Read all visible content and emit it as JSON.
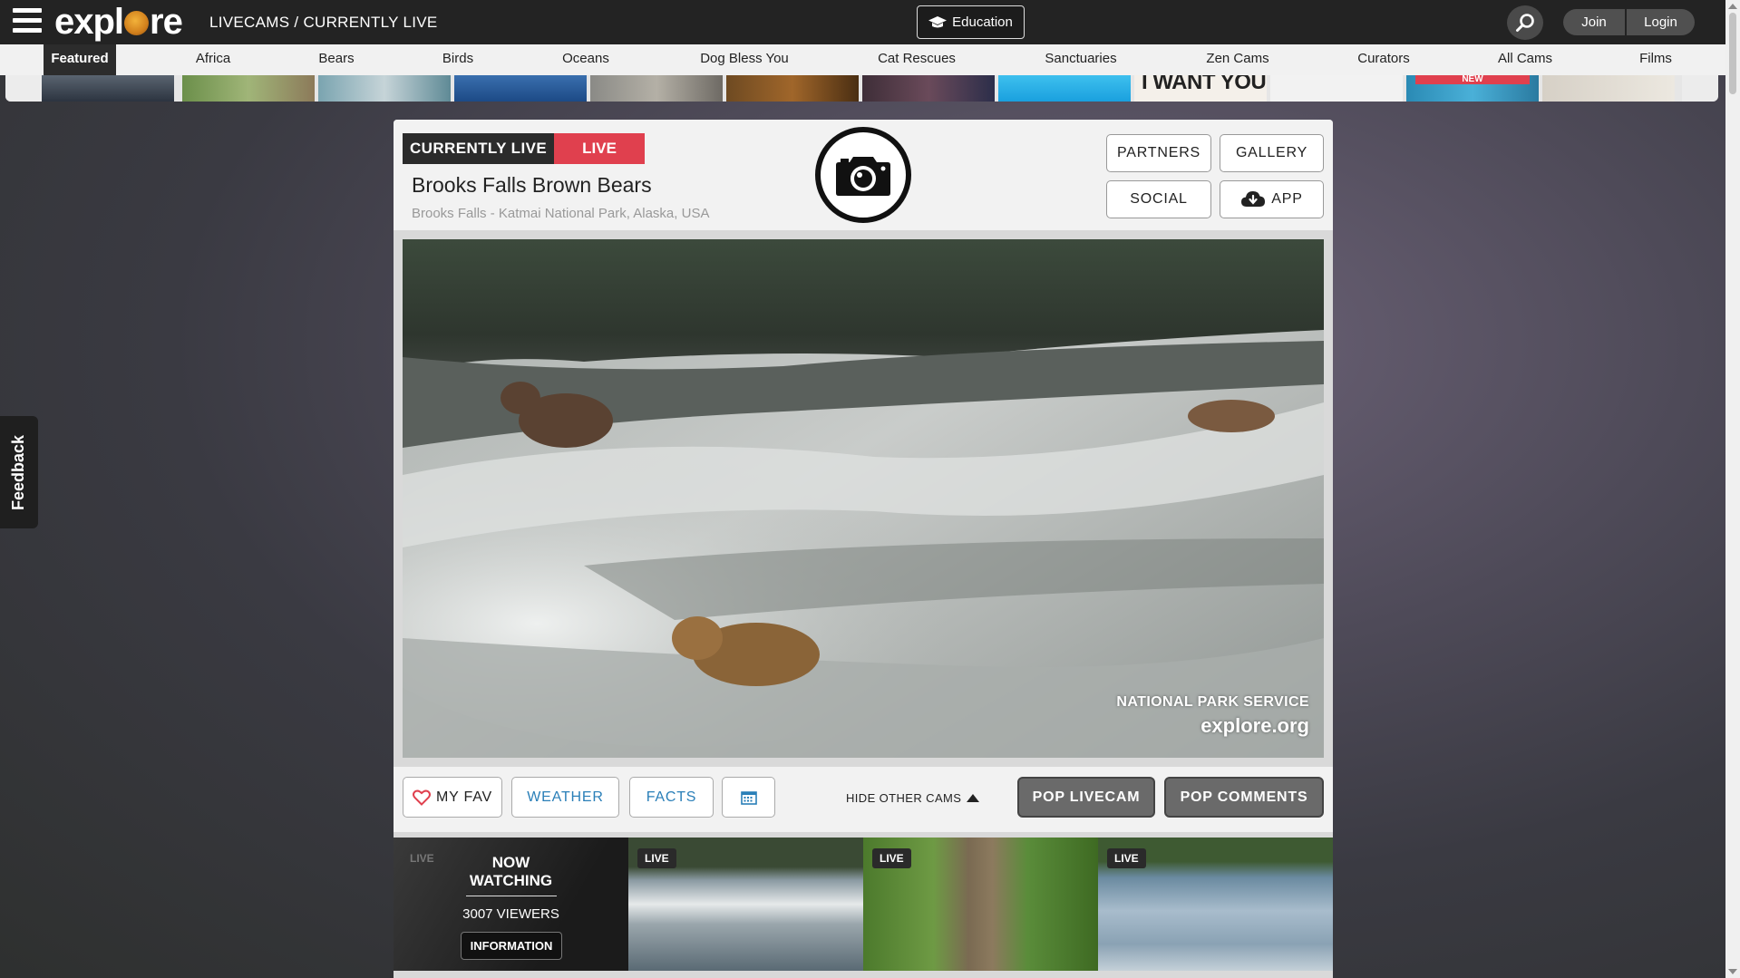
{
  "topbar": {
    "logo_text_a": "expl",
    "logo_text_b": "re",
    "breadcrumb": "LIVECAMS / CURRENTLY LIVE",
    "education_label": "Education",
    "join_label": "Join",
    "login_label": "Login"
  },
  "catnav": {
    "items": [
      "Featured",
      "Africa",
      "Bears",
      "Birds",
      "Oceans",
      "Dog Bless You",
      "Cat Rescues",
      "Sanctuaries",
      "Zen Cams",
      "Curators",
      "All Cams",
      "Films"
    ],
    "active": "Featured"
  },
  "thumbstrip": {
    "captions": [
      "I WANT YOU",
      "NEW"
    ]
  },
  "feedback_label": "Feedback",
  "panel": {
    "badge_left": "CURRENTLY LIVE",
    "badge_right": "LIVE",
    "title": "Brooks Falls Brown Bears",
    "location": "Brooks Falls - Katmai National Park, Alaska, USA",
    "buttons": {
      "partners": "PARTNERS",
      "gallery": "GALLERY",
      "social": "SOCIAL",
      "app": "APP"
    },
    "video": {
      "watermark_line1": "NATIONAL PARK SERVICE",
      "watermark_line2": "explore.org"
    },
    "controls": {
      "my_fav": "MY FAV",
      "weather": "WEATHER",
      "facts": "FACTS",
      "hide_other_cams": "HIDE OTHER CAMS",
      "pop_livecam": "POP LIVECAM",
      "pop_comments": "POP COMMENTS"
    },
    "other_cams": {
      "live_label": "LIVE",
      "now_watching_line1": "NOW",
      "now_watching_line2": "WATCHING",
      "viewers": "3007 VIEWERS",
      "information": "INFORMATION"
    }
  },
  "colors": {
    "live_red": "#e0404e",
    "link_blue": "#2a7fb8",
    "topbar_bg": "#232323"
  }
}
